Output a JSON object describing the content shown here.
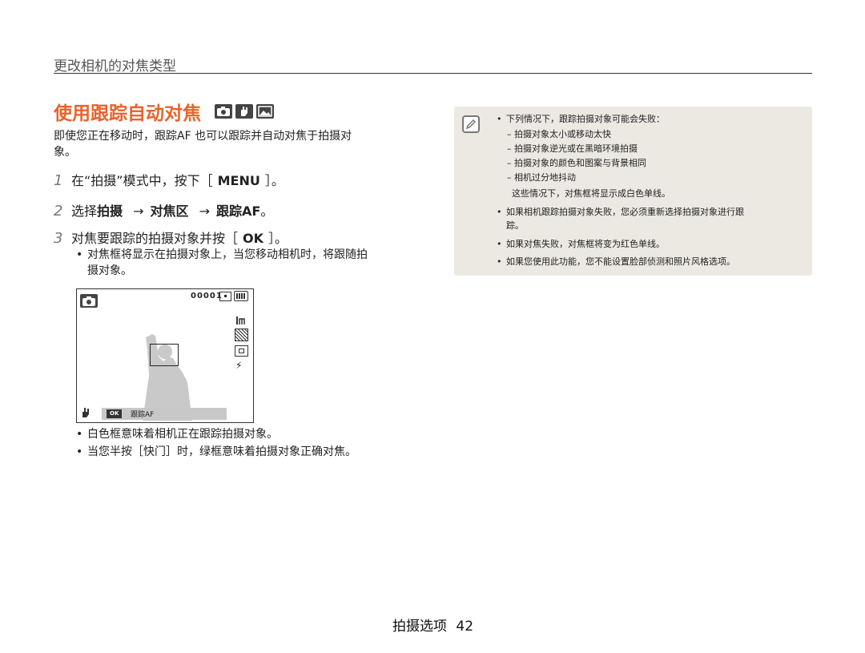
{
  "header": {
    "section_title": "更改相机的对焦类型"
  },
  "heading": {
    "title": "使用跟踪自动对焦",
    "mode_icons": [
      "smart-camera-icon",
      "dual-is-icon",
      "scene-icon"
    ]
  },
  "intro": {
    "line1": "即使您正在移动时，跟踪AF 也可以跟踪并自动对焦于拍摄对",
    "line2": "象。"
  },
  "steps": [
    {
      "num": "1",
      "text": "在“拍摄”模式中，按下",
      "key": "MENU",
      "end": "。"
    },
    {
      "num": "2",
      "pre": "选择",
      "a": "拍摄",
      "arrow1": "→",
      "b": "对焦区",
      "arrow2": "→",
      "c": "跟踪AF",
      "end": "。"
    },
    {
      "num": "3",
      "text": "对焦要跟踪的拍摄对象并按",
      "key": "OK",
      "end": "。"
    }
  ],
  "step3_bullet": {
    "line1": "对焦框将显示在拍摄对象上，当您移动相机时，将跟随拍",
    "line2": "摄对象。"
  },
  "screen": {
    "counter": "00001",
    "ok_label": "OK",
    "af_label": "跟踪AF"
  },
  "bottom_bullets": [
    "白色框意味着相机正在跟踪拍摄对象。",
    "当您半按［快门］时，绿框意味着拍摄对象正确对焦。"
  ],
  "note": {
    "b1": "下列情况下，跟踪拍摄对象可能会失败：",
    "dashes": [
      "拍摄对象太小或移动太快",
      "拍摄对象逆光或在黑暗环境拍摄",
      "拍摄对象的颜色和图案与背景相同",
      "相机过分地抖动"
    ],
    "after": "这些情况下，对焦框将显示成白色单线。",
    "b2_line1": "如果相机跟踪拍摄对象失败，您必须重新选择拍摄对象进行跟",
    "b2_line2": "踪。",
    "b3": "如果对焦失败，对焦框将变为红色单线。",
    "b4": "如果您使用此功能，您不能设置脸部侦测和照片风格选项。"
  },
  "footer": {
    "label": "拍摄选项",
    "page": "42"
  }
}
